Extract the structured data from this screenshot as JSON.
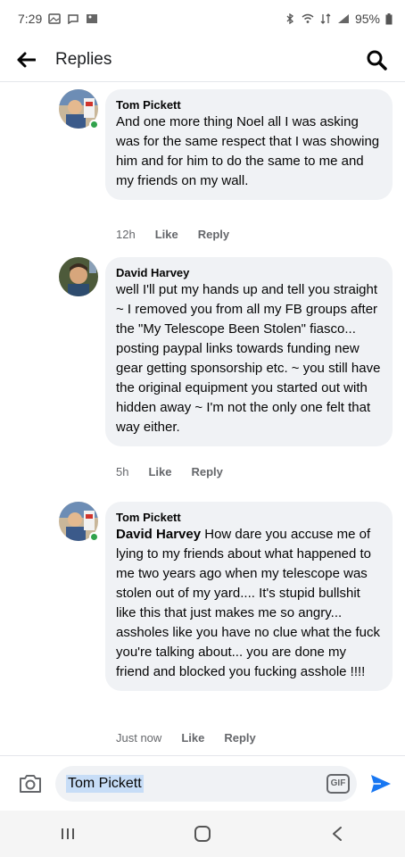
{
  "status_bar": {
    "time": "7:29",
    "battery": "95%"
  },
  "header": {
    "title": "Replies"
  },
  "comments": [
    {
      "author": "Tom Pickett",
      "text": "And one more thing Noel all I was asking was for the same respect that I was showing him and for him to do the same to me and my friends on my wall.",
      "time": "12h",
      "like_label": "Like",
      "reply_label": "Reply",
      "online": true
    },
    {
      "author": "David Harvey",
      "text": "well I'll put my hands up and tell you straight ~ I removed you from all my FB groups after the \"My Telescope Been Stolen\" fiasco... posting paypal links towards funding new gear getting sponsorship etc. ~  you still have the original equipment you started out with hidden away ~ I'm not the only one felt that way either.",
      "time": "5h",
      "like_label": "Like",
      "reply_label": "Reply",
      "online": false
    },
    {
      "author": "Tom Pickett",
      "mention": "David Harvey",
      "text": " How dare you accuse me of lying to my friends about what happened to me two years ago when my telescope was stolen out of my yard.... It's stupid bullshit like this that just makes me so angry... assholes like you have no clue what the fuck you're talking about... you are done my friend and blocked you fucking asshole !!!!",
      "time": "Just now",
      "like_label": "Like",
      "reply_label": "Reply",
      "online": true
    }
  ],
  "composer": {
    "mention_value": "Tom Pickett",
    "gif_label": "GIF"
  },
  "colors": {
    "accent": "#1877f2",
    "bubble": "#f0f2f5",
    "meta": "#65676b",
    "online": "#31a24c"
  }
}
